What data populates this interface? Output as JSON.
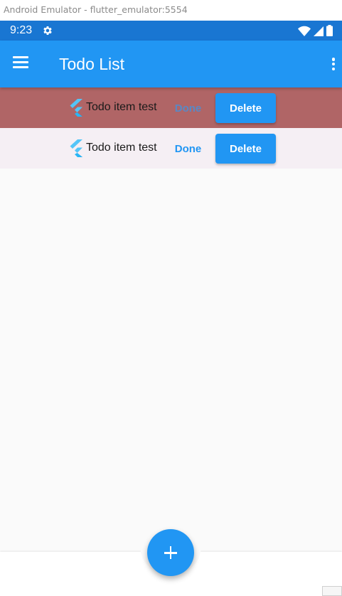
{
  "window": {
    "title": "Android Emulator - flutter_emulator:5554"
  },
  "statusbar": {
    "time": "9:23",
    "icons": [
      "gear-icon",
      "wifi-icon",
      "signal-icon",
      "battery-icon"
    ]
  },
  "appbar": {
    "title": "Todo List",
    "menu_icon": "menu-icon",
    "overflow_icon": "more-vert-icon"
  },
  "todos": [
    {
      "text": "Todo item test",
      "done_label": "Done",
      "delete_label": "Delete",
      "highlighted": true
    },
    {
      "text": "Todo item test",
      "done_label": "Done",
      "delete_label": "Delete",
      "highlighted": false
    }
  ],
  "fab": {
    "icon": "add-icon"
  },
  "colors": {
    "primary": "#2196f3",
    "status_bar": "#1976d2",
    "highlight_row": "#b06566",
    "row_bg": "#f5eff4",
    "background": "#fafafa"
  }
}
